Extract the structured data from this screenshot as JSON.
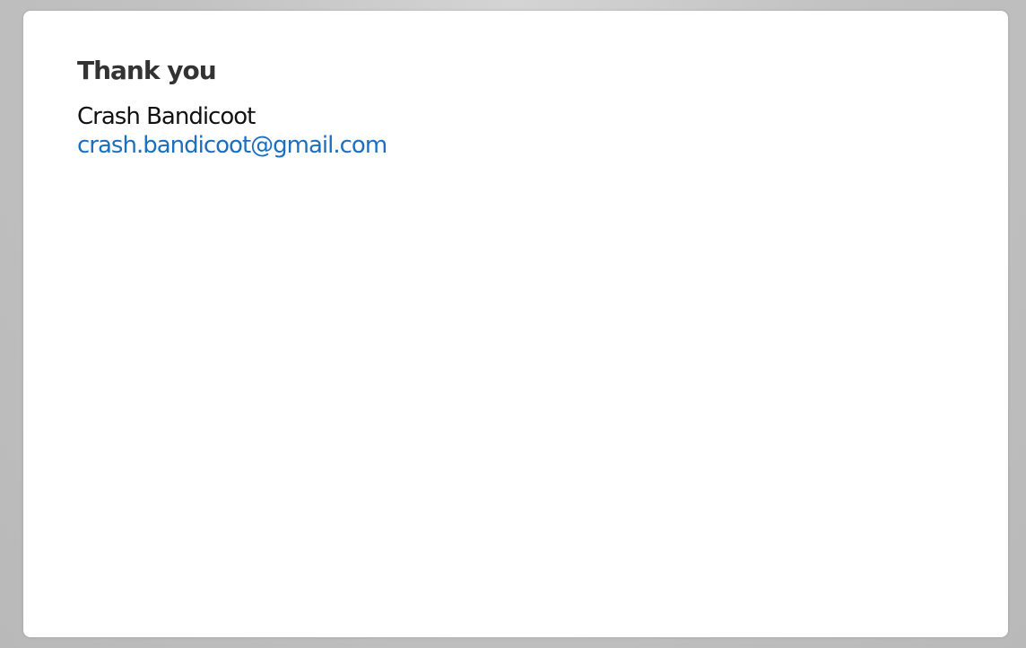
{
  "confirmation": {
    "heading": "Thank you",
    "name": "Crash Bandicoot",
    "email": "crash.bandicoot@gmail.com"
  },
  "colors": {
    "link": "#1a6fc0",
    "heading": "#333333",
    "card_background": "#ffffff",
    "page_background": "#c2c2c2"
  }
}
